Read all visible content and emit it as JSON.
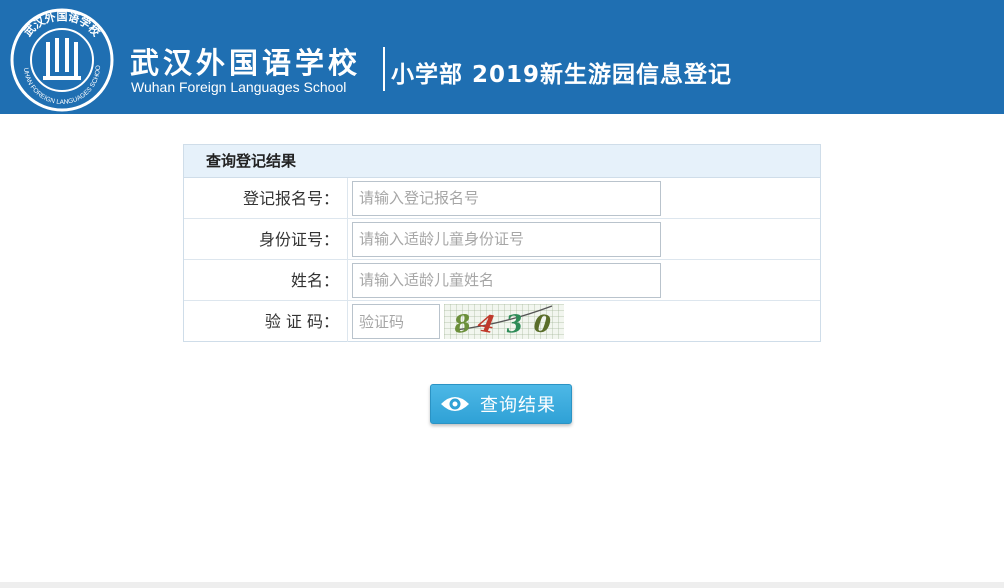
{
  "header": {
    "school_name_cn": "武汉外国语学校",
    "school_name_en": "Wuhan Foreign Languages School",
    "page_title": "小学部 2019新生游园信息登记",
    "logo": {
      "ring_text_top": "武汉外国语学校",
      "ring_text_bottom": "WUHAN FOREIGN LANGUAGES SCHOOL"
    },
    "background_color": "#1f6fb2"
  },
  "form": {
    "title": "查询登记结果",
    "fields": [
      {
        "label": "登记报名号：",
        "placeholder": "请输入登记报名号",
        "value": ""
      },
      {
        "label": "身份证号：",
        "placeholder": "请输入适龄儿童身份证号",
        "value": ""
      },
      {
        "label": "姓名：",
        "placeholder": "请输入适龄儿童姓名",
        "value": ""
      }
    ],
    "captcha": {
      "label": "验 证 码：",
      "placeholder": "验证码",
      "value": "",
      "chars": [
        "8",
        "4",
        "3",
        "0"
      ],
      "char_colors": [
        "#6b8f3a",
        "#c0392b",
        "#2e8b57",
        "#5a6e2a"
      ]
    }
  },
  "actions": {
    "query_label": "查询结果",
    "icon": "eye-icon",
    "button_color": "#3aa9dd"
  }
}
